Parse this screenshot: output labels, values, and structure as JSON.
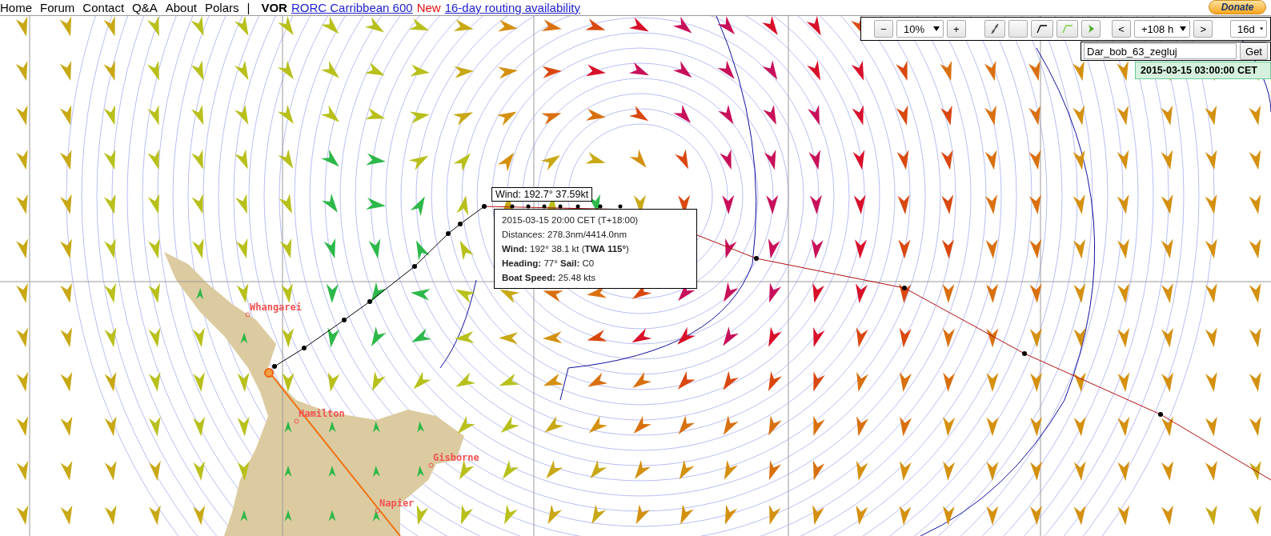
{
  "nav": {
    "links": [
      {
        "label": "Home"
      },
      {
        "label": "Forum"
      },
      {
        "label": "Contact"
      },
      {
        "label": "Q&A"
      },
      {
        "label": "About"
      },
      {
        "label": "Polars"
      }
    ],
    "separator": "|",
    "brand": "VOR",
    "race_link": "RORC Carribbean 600",
    "badge": "New",
    "promo_link": "16-day routing availability"
  },
  "donate": "Donate",
  "toolbar": {
    "zoom_out": "−",
    "zoom": "10%",
    "zoom_in": "+",
    "prev": "<",
    "offset": "+108 h",
    "next": ">",
    "range": "16d"
  },
  "boat_search": {
    "value": "Dar_bob_63_zegluj",
    "button": "Get"
  },
  "forecast_time": "2015-03-15 03:00:00 CET",
  "map": {
    "wind_label": "Wind: 192.7° 37.59kt",
    "tooltip": [
      "2015-03-15 20:00 CET (T+18:00)",
      "Distances: 278.3nm/4414.0nm",
      "**Wind:** 192° 38.1 kt (**TWA 115°**)",
      "**Heading:** 77° **Sail:** C0",
      "**Boat Speed:** 25.48 kts"
    ],
    "cities": [
      {
        "name": "Whangarei"
      },
      {
        "name": "Hamilton"
      },
      {
        "name": "Gisborne"
      },
      {
        "name": "Napier"
      }
    ]
  }
}
